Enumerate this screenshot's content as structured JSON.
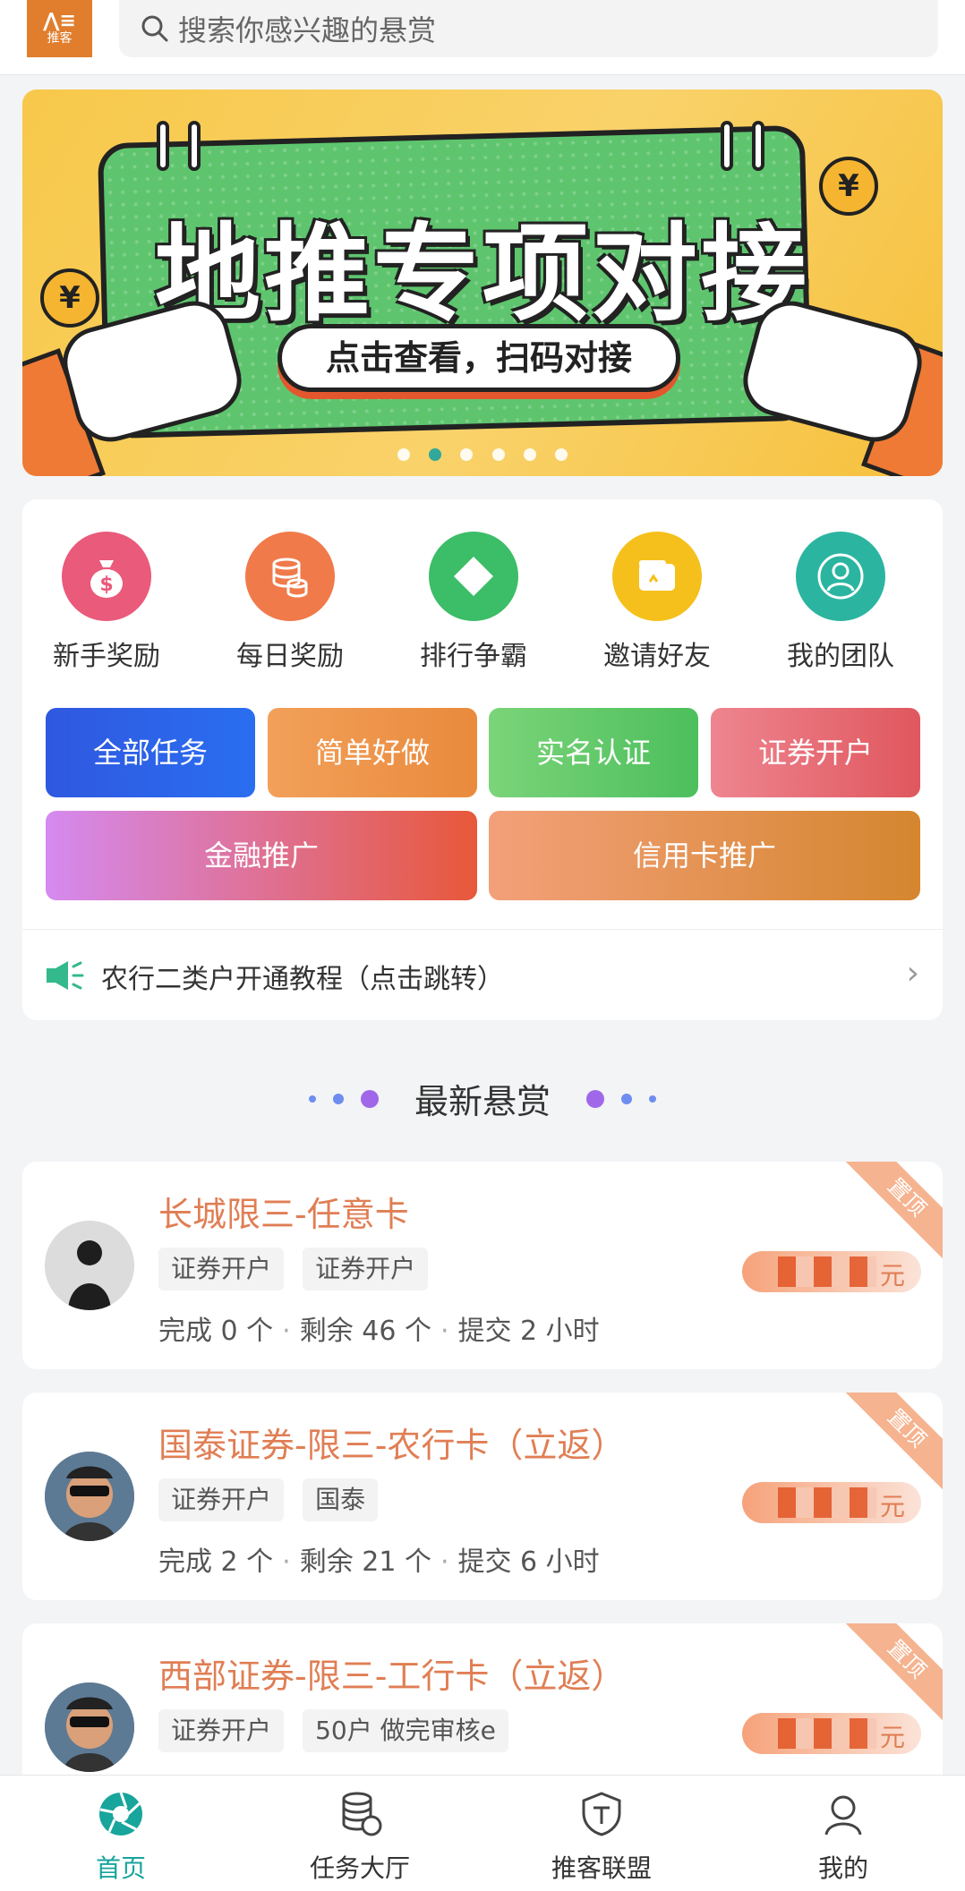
{
  "header": {
    "logo_text": "推客",
    "search_placeholder": "搜索你感兴趣的悬赏"
  },
  "banner": {
    "title": "地推专项对接",
    "subtitle": "点击查看，扫码对接",
    "coin_symbol": "¥",
    "dot_count": 6,
    "active_dot": 1
  },
  "quick_icons": [
    {
      "label": "新手奖励",
      "icon": "money-bag-icon",
      "color": "#ea5a7a"
    },
    {
      "label": "每日奖励",
      "icon": "coins-stack-icon",
      "color": "#f07a4a"
    },
    {
      "label": "排行争霸",
      "icon": "diamond-icon",
      "color": "#3cbd67"
    },
    {
      "label": "邀请好友",
      "icon": "wallet-icon",
      "color": "#f5c01c"
    },
    {
      "label": "我的团队",
      "icon": "user-icon",
      "color": "#2bb5a0"
    }
  ],
  "category_tiles": [
    {
      "label": "全部任务"
    },
    {
      "label": "简单好做"
    },
    {
      "label": "实名认证"
    },
    {
      "label": "证券开户"
    },
    {
      "label": "金融推广"
    },
    {
      "label": "信用卡推广"
    }
  ],
  "notice": {
    "text": "农行二类户开通教程（点击跳转）"
  },
  "section_title": "最新悬赏",
  "tasks": [
    {
      "title": "长城限三-任意卡",
      "tags": [
        "证券开户",
        "证券开户"
      ],
      "done": "完成 0 个",
      "remain": "剩余 46 个",
      "submit": "提交 2 小时",
      "badge": "置顶",
      "reward_unit": "元"
    },
    {
      "title": "国泰证券-限三-农行卡（立返）",
      "tags": [
        "证券开户",
        "国泰"
      ],
      "done": "完成 2 个",
      "remain": "剩余 21 个",
      "submit": "提交 6 小时",
      "badge": "置顶",
      "reward_unit": "元"
    },
    {
      "title": "西部证券-限三-工行卡（立返）",
      "tags": [
        "证券开户",
        "50户 做完审核e"
      ],
      "badge": "置顶",
      "reward_unit": "元"
    }
  ],
  "bottom_nav": [
    {
      "label": "首页",
      "icon": "aperture-icon",
      "active": true
    },
    {
      "label": "任务大厅",
      "icon": "database-icon",
      "active": false
    },
    {
      "label": "推客联盟",
      "icon": "shield-icon",
      "active": false
    },
    {
      "label": "我的",
      "icon": "user-icon",
      "active": false
    }
  ]
}
